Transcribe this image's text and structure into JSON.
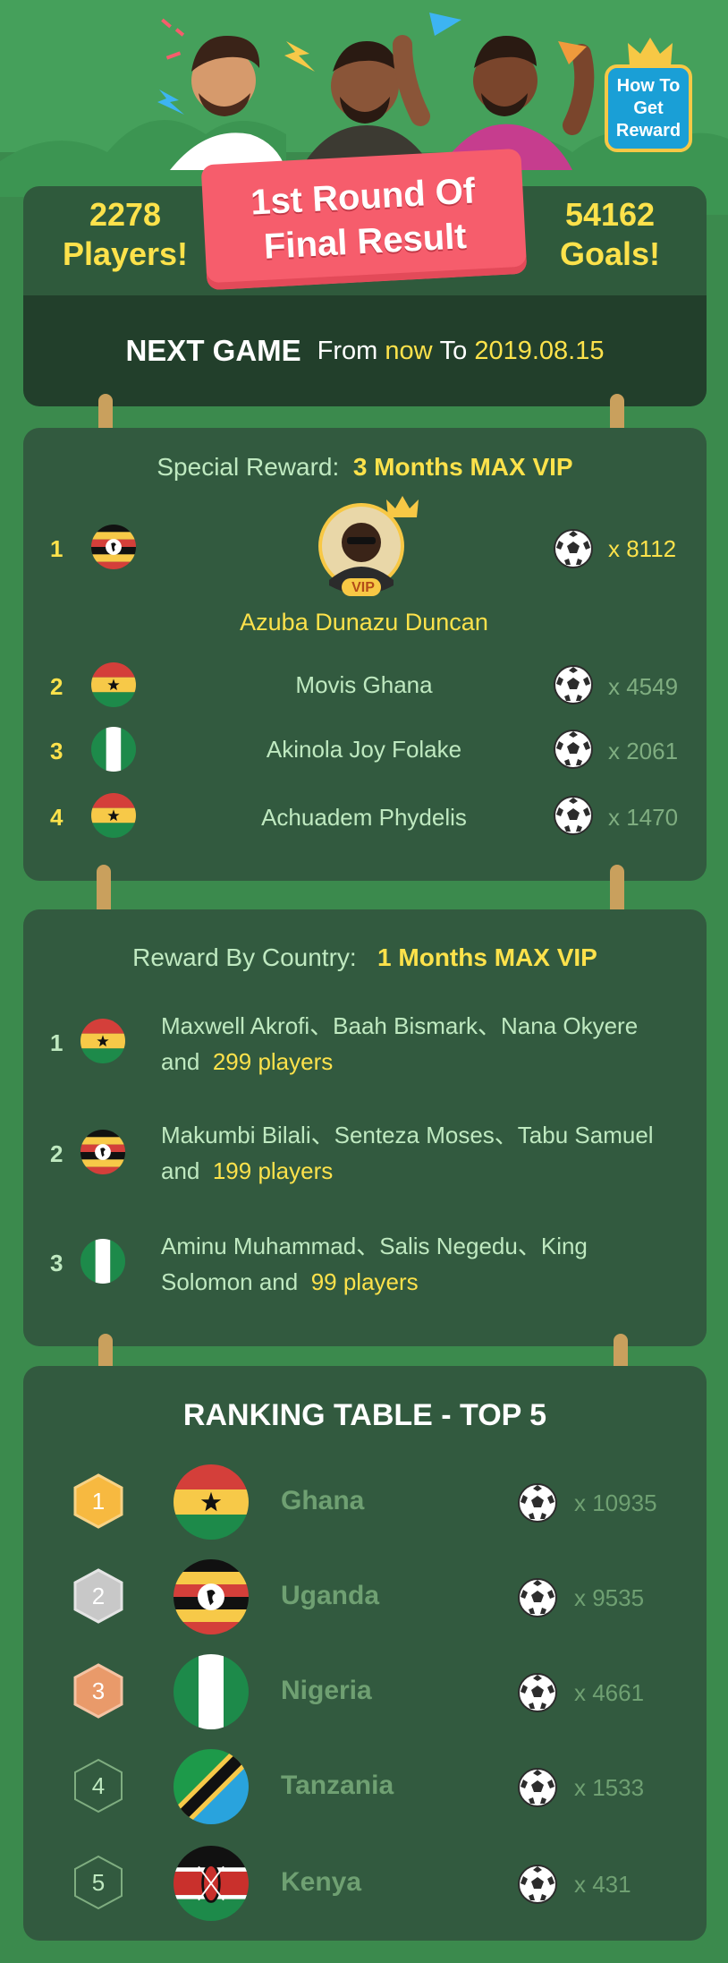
{
  "header": {
    "banner_line1": "1st Round Of",
    "banner_line2": "Final Result",
    "players_count": "2278",
    "players_label": "Players!",
    "goals_count": "54162",
    "goals_label": "Goals!",
    "how_to": [
      "How To",
      "Get",
      "Reward"
    ]
  },
  "next_game": {
    "title": "NEXT GAME",
    "from": "From",
    "now": "now",
    "to": "To",
    "date": "2019.08.15"
  },
  "special": {
    "label": "Special Reward:",
    "reward": "3 Months MAX VIP",
    "vip_badge": "VIP",
    "winner_name": "Azuba Dunazu Duncan",
    "rows": [
      {
        "rank": "1",
        "country": "uganda",
        "count": "x 8112"
      },
      {
        "rank": "2",
        "name": "Movis Ghana",
        "country": "ghana",
        "count": "x 4549"
      },
      {
        "rank": "3",
        "name": "Akinola Joy Folake",
        "country": "nigeria",
        "count": "x 2061"
      },
      {
        "rank": "4",
        "name": "Achuadem Phydelis",
        "country": "ghana",
        "count": "x 1470"
      }
    ]
  },
  "by_country": {
    "label": "Reward By Country:",
    "reward": "1 Months MAX VIP",
    "rows": [
      {
        "rank": "1",
        "country": "ghana",
        "names": "Maxwell Akrofi、Baah Bismark、Nana Okyere",
        "and": "and",
        "players": "299 players"
      },
      {
        "rank": "2",
        "country": "uganda",
        "names": "Makumbi Bilali、Senteza Moses、Tabu Samuel",
        "and": "and",
        "players": "199 players"
      },
      {
        "rank": "3",
        "country": "nigeria",
        "names": "Aminu Muhammad、Salis Negedu、King",
        "names2": "Solomon and",
        "players": "99 players"
      }
    ]
  },
  "ranking": {
    "title": "RANKING TABLE - TOP 5",
    "rows": [
      {
        "rank": "1",
        "country": "Ghana",
        "count": "x 10935",
        "medal": "#f7b940"
      },
      {
        "rank": "2",
        "country": "Uganda",
        "count": "x 9535",
        "medal": "#c8c8c8"
      },
      {
        "rank": "3",
        "country": "Nigeria",
        "count": "x 4661",
        "medal": "#e99a6a"
      },
      {
        "rank": "4",
        "country": "Tanzania",
        "count": "x 1533",
        "medal": ""
      },
      {
        "rank": "5",
        "country": "Kenya",
        "count": "x 431",
        "medal": ""
      }
    ]
  },
  "colors": {
    "background": "#3b8a4d",
    "card": "#325a3f",
    "accent_yellow": "#fde24b",
    "banner_red": "#f65d6c"
  }
}
